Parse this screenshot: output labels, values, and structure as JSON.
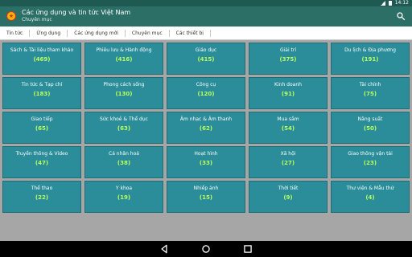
{
  "status": {
    "time": "14:12"
  },
  "appbar": {
    "title": "Các ứng dụng và tin tức Việt Nam",
    "subtitle": "Chuyên mục"
  },
  "tabs": [
    "Tin tức",
    "Ứng dụng",
    "Các ứng dụng mới",
    "Chuyên mục",
    "Các thiết bị"
  ],
  "categories": [
    {
      "name": "Sách & Tài liệu tham khảo",
      "count": "(469)"
    },
    {
      "name": "Phiêu lưu & Hành động",
      "count": "(416)"
    },
    {
      "name": "Giáo dục",
      "count": "(415)"
    },
    {
      "name": "Giải trí",
      "count": "(375)"
    },
    {
      "name": "Du lịch & Địa phương",
      "count": "(191)"
    },
    {
      "name": "Tin tức & Tạp chí",
      "count": "(183)"
    },
    {
      "name": "Phong cách sống",
      "count": "(130)"
    },
    {
      "name": "Công cụ",
      "count": "(120)"
    },
    {
      "name": "Kinh doanh",
      "count": "(91)"
    },
    {
      "name": "Tài chính",
      "count": "(75)"
    },
    {
      "name": "Giao tiếp",
      "count": "(65)"
    },
    {
      "name": "Sức khoẻ & Thể dục",
      "count": "(63)"
    },
    {
      "name": "Âm nhạc & Âm thanh",
      "count": "(62)"
    },
    {
      "name": "Mua sắm",
      "count": "(54)"
    },
    {
      "name": "Năng suất",
      "count": "(50)"
    },
    {
      "name": "Truyền thông & Video",
      "count": "(47)"
    },
    {
      "name": "Cá nhân hoá",
      "count": "(38)"
    },
    {
      "name": "Hoạt hình",
      "count": "(33)"
    },
    {
      "name": "Xã hội",
      "count": "(27)"
    },
    {
      "name": "Giao thông vận tải",
      "count": "(23)"
    },
    {
      "name": "Thể thao",
      "count": "(22)"
    },
    {
      "name": "Y khoa",
      "count": "(19)"
    },
    {
      "name": "Nhiếp ảnh",
      "count": "(15)"
    },
    {
      "name": "Thời tiết",
      "count": "(9)"
    },
    {
      "name": "Thư viện & Mẫu thử",
      "count": "(4)"
    }
  ],
  "colors": {
    "appbar": "#2b6f66",
    "tile": "#2a8d99",
    "count": "#b8ff5c"
  },
  "icons": {
    "search": "search-icon",
    "back": "back-icon",
    "home": "home-icon",
    "recents": "recents-icon"
  }
}
